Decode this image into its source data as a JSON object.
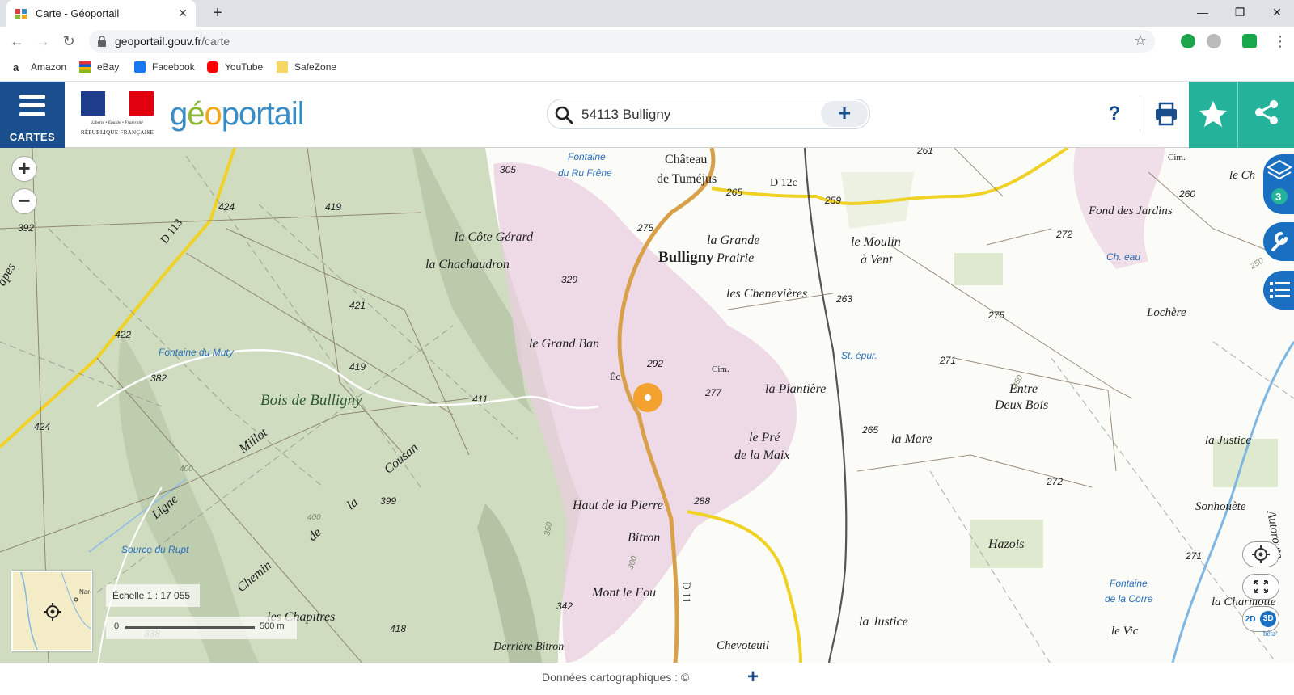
{
  "browser": {
    "tab_title": "Carte - Géoportail",
    "url_host": "geoportail.gouv.fr",
    "url_path": "/carte",
    "bookmarks": [
      {
        "label": "Amazon"
      },
      {
        "label": "eBay"
      },
      {
        "label": "Facebook"
      },
      {
        "label": "YouTube"
      },
      {
        "label": "SafeZone"
      }
    ]
  },
  "header": {
    "menu_label": "CARTES",
    "motto": "Liberté • Égalité • Fraternité",
    "republic": "RÉPUBLIQUE FRANÇAISE",
    "search_value": "54113 Bulligny",
    "help_label": "?"
  },
  "layers_count": "3",
  "map": {
    "scale_label": "Échelle 1 : 17 055",
    "scale_zero": "0",
    "scale_dist": "500 m",
    "minimap_label": "Nar",
    "mode_2d": "2D",
    "mode_3d": "3D",
    "mode_beta": "bêta",
    "labels": {
      "chateau": "Château",
      "tumejus": "de Tuméjus",
      "bulligny": "Bulligny",
      "grande": "la Grande",
      "prairie": "Prairie",
      "moulin": "le Moulin",
      "avent": "à Vent",
      "fond_jardins": "Fond des Jardins",
      "le_che": "le Ch",
      "cote_gerard": "la Côte Gérard",
      "chachaudron": "la Chachaudron",
      "chenevieres": "les Chenevières",
      "lochere": "Lochère",
      "grand_ban": "le Grand Ban",
      "plantiere": "la Plantière",
      "entre": "Entre",
      "deux_bois": "Deux Bois",
      "bois_bulligny": "Bois de Bulligny",
      "le_pre": "le Pré",
      "de_la_maix": "de la Maix",
      "la_mare": "la Mare",
      "la_justice_r": "la Justice",
      "millot": "Millot",
      "cousan": "Cousan",
      "la": "la",
      "de": "de",
      "ligne": "Ligne",
      "chemin": "Chemin",
      "haut_pierre": "Haut de la Pierre",
      "bitron": "Bitron",
      "sonhouete": "Sonhouète",
      "hazois": "Hazois",
      "mont_fou": "Mont le Fou",
      "chapitres": "les Chapitres",
      "justice": "la Justice",
      "charmotte": "la Charmotte",
      "le_vic": "le Vic",
      "derriere_bitron": "Derrière Bitron",
      "chevoteuil": "Chevoteuil",
      "autoroute": "Autoroute",
      "apes": "apes",
      "ec": "Éc",
      "cim1": "Cim.",
      "cim2": "Cim."
    },
    "water_labels": {
      "fontaine_ru": "Fontaine",
      "fontaine_ru2": "du Ru Frêne",
      "fontaine_muty": "Fontaine du Muty",
      "source_rupt": "Source du Rupt",
      "ch_eau": "Ch. eau",
      "st_epur": "St. épur.",
      "fontaine_corre": "Fontaine",
      "fontaine_corre2": "de la Corre"
    },
    "roads": {
      "d113": "D 113",
      "d12c": "D 12c",
      "d11": "D 11"
    },
    "spot_heights": {
      "h305": "305",
      "h261": "261",
      "h265a": "265",
      "h259": "259",
      "h260": "260",
      "h424a": "424",
      "h419a": "419",
      "h392": "392",
      "h275a": "275",
      "h272a": "272",
      "h329": "329",
      "h421": "421",
      "h263": "263",
      "h422": "422",
      "h275b": "275",
      "h271a": "271",
      "h292": "292",
      "h419b": "419",
      "h382": "382",
      "h277": "277",
      "h411": "411",
      "h424b": "424",
      "h265b": "265",
      "h272b": "272",
      "h399": "399",
      "h288": "288",
      "h342": "342",
      "h418": "418",
      "h338": "338",
      "h271b": "271",
      "h400a": "400",
      "h400b": "400",
      "h350": "350",
      "h300": "300",
      "h250a": "250",
      "h250b": "250"
    }
  },
  "footer": {
    "credit": "Données cartographiques : ©"
  },
  "colors": {
    "brand_blue": "#1a4e8c",
    "teal": "#24b29b",
    "forest": "#cfdcc0",
    "urban": "#e9cde0",
    "road_main": "#d9a04a",
    "road_yellow": "#f0d227"
  }
}
